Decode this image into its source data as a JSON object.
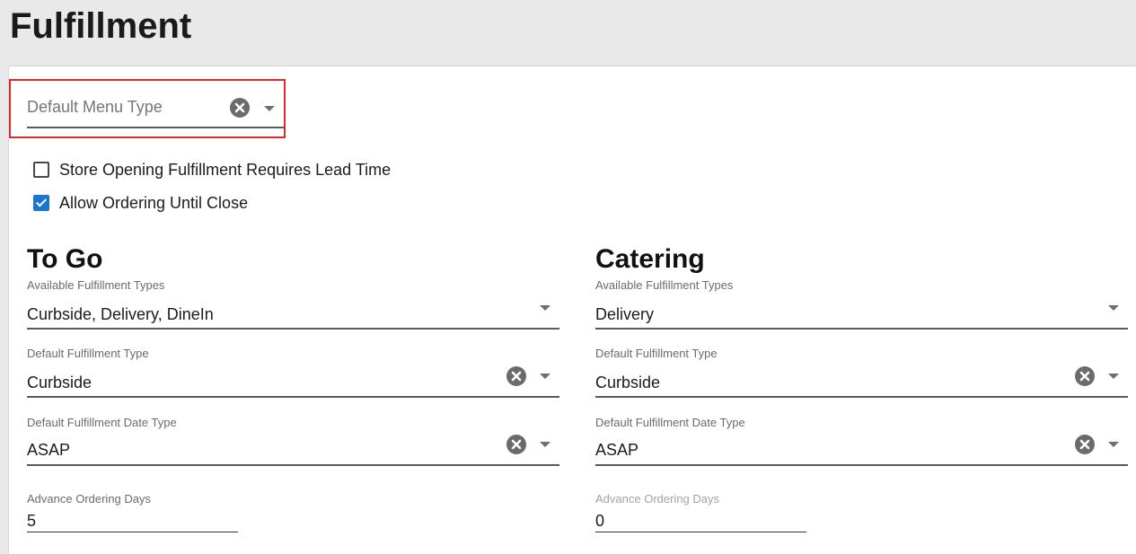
{
  "page": {
    "title": "Fulfillment"
  },
  "menu_type": {
    "placeholder": "Default Menu Type",
    "clear_icon": "clear-circle-icon",
    "dropdown_icon": "chevron-down-icon",
    "highlight_color": "#d92d2d"
  },
  "options": {
    "lead_time": {
      "label": "Store Opening Fulfillment Requires Lead Time",
      "checked": false
    },
    "order_until_close": {
      "label": "Allow Ordering Until Close",
      "checked": true
    },
    "checkbox_color": "#1976d2"
  },
  "togo": {
    "title": "To Go",
    "available_types": {
      "label": "Available Fulfillment Types",
      "value": "Curbside, Delivery, DineIn"
    },
    "default_type": {
      "label": "Default Fulfillment Type",
      "value": "Curbside"
    },
    "default_date_type": {
      "label": "Default Fulfillment Date Type",
      "value": "ASAP"
    },
    "advance_days": {
      "label": "Advance Ordering Days",
      "value": "5"
    }
  },
  "catering": {
    "title": "Catering",
    "available_types": {
      "label": "Available Fulfillment Types",
      "value": "Delivery"
    },
    "default_type": {
      "label": "Default Fulfillment Type",
      "value": "Curbside"
    },
    "default_date_type": {
      "label": "Default Fulfillment Date Type",
      "value": "ASAP"
    },
    "advance_days": {
      "label": "Advance Ordering Days",
      "value": "0"
    }
  }
}
